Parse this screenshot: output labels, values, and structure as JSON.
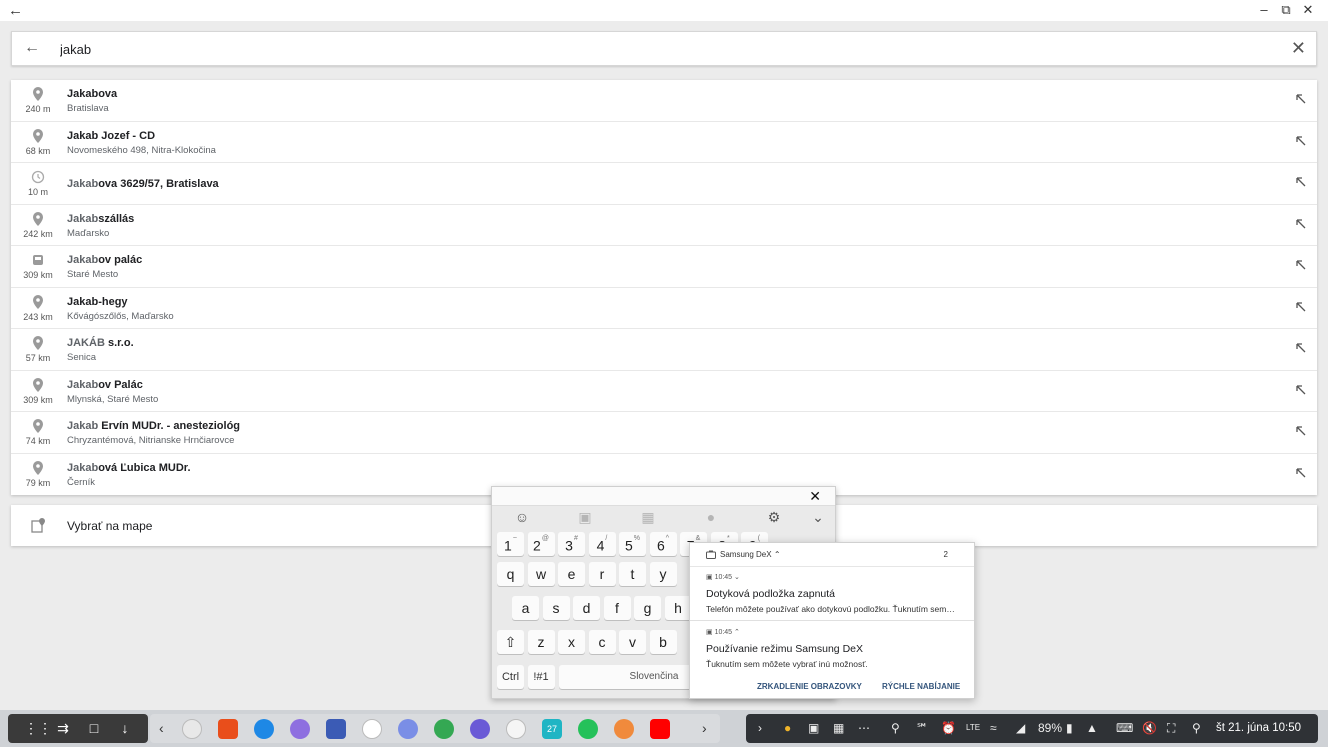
{
  "window": {
    "back_icon": "arrow-left-icon",
    "controls": [
      "minimize-icon",
      "restore-icon",
      "close-icon"
    ]
  },
  "search": {
    "value": "jakab",
    "back_icon": "arrow-left-icon",
    "clear_icon": "close-icon"
  },
  "results": [
    {
      "icon": "place-pin-icon",
      "distance": "240 m",
      "match": "Jakabova",
      "rest": "",
      "subtitle": "Bratislava",
      "match_dim": false
    },
    {
      "icon": "place-pin-icon",
      "distance": "68 km",
      "match": "Jakab Jozef - CD",
      "rest": "",
      "subtitle": "Novomeského 498, Nitra-Klokočina",
      "match_dim": false
    },
    {
      "icon": "history-clock-icon",
      "distance": "10 m",
      "match": "Jakab",
      "rest": "ova 3629/57, Bratislava",
      "subtitle": "",
      "match_dim": true
    },
    {
      "icon": "place-pin-icon",
      "distance": "242 km",
      "match": "Jakab",
      "rest": "szállás",
      "subtitle": "Maďarsko",
      "match_dim": true
    },
    {
      "icon": "bus-stop-icon",
      "distance": "309 km",
      "match": "Jakab",
      "rest": "ov palác",
      "subtitle": "Staré Mesto",
      "match_dim": true
    },
    {
      "icon": "place-pin-icon",
      "distance": "243 km",
      "match": "Jakab-hegy",
      "rest": "",
      "subtitle": "Kővágószőlős, Maďarsko",
      "match_dim": false
    },
    {
      "icon": "place-pin-icon",
      "distance": "57 km",
      "match": "JAKÁB",
      "rest": " s.r.o.",
      "subtitle": "Senica",
      "match_dim": true
    },
    {
      "icon": "place-pin-icon",
      "distance": "309 km",
      "match": "Jakab",
      "rest": "ov Palác",
      "subtitle": "Mlynská, Staré Mesto",
      "match_dim": true
    },
    {
      "icon": "place-pin-icon",
      "distance": "74 km",
      "match": "Jakab",
      "rest": " Ervín MUDr. - anesteziológ",
      "subtitle": "Chryzantémová, Nitrianske Hrnčiarovce",
      "match_dim": true
    },
    {
      "icon": "place-pin-icon",
      "distance": "79 km",
      "match": "Jakab",
      "rest": "ová Ľubica MUDr.",
      "subtitle": "Černík",
      "match_dim": true
    }
  ],
  "map_select": {
    "label": "Vybrať na mape",
    "icon": "map-pin-select-icon"
  },
  "keyboard": {
    "tools": [
      "emoji-icon",
      "sticker-icon",
      "gif-icon",
      "mic-icon",
      "settings-icon",
      "chevron-down-icon"
    ],
    "close_icon": "close-icon",
    "number_row": [
      {
        "k": "1",
        "s": "~"
      },
      {
        "k": "2",
        "s": "@"
      },
      {
        "k": "3",
        "s": "#"
      },
      {
        "k": "4",
        "s": "/"
      },
      {
        "k": "5",
        "s": "%"
      },
      {
        "k": "6",
        "s": "^"
      },
      {
        "k": "7",
        "s": "&"
      },
      {
        "k": "8",
        "s": "*"
      },
      {
        "k": "9",
        "s": "("
      }
    ],
    "row1": [
      "q",
      "w",
      "e",
      "r",
      "t",
      "y"
    ],
    "row2": [
      "a",
      "s",
      "d",
      "f",
      "g",
      "h"
    ],
    "row3": [
      "z",
      "x",
      "c",
      "v",
      "b"
    ],
    "ctrl": "Ctrl",
    "symbols": "!#1",
    "space_label": "Slovenčina",
    "shift_icon": "shift-icon"
  },
  "notification": {
    "app_name": "Samsung DeX",
    "count": "2",
    "items": [
      {
        "time": "10:45",
        "title": "Dotyková podložka zapnutá",
        "text": "Telefón môžete používať ako dotykovú podložku. Ťuknutím sem…"
      },
      {
        "time": "10:45",
        "title": "Používanie režimu Samsung DeX",
        "text": "Ťuknutím sem môžete vybrať inú možnosť."
      }
    ],
    "actions": [
      "ZRKADLENIE OBRAZOVKY",
      "RÝCHLE NABÍJANIE"
    ]
  },
  "taskbar": {
    "left_icons": [
      "apps-grid-icon",
      "recents-icon",
      "square-icon",
      "download-icon"
    ],
    "apps": [
      {
        "name": "gmail-icon",
        "color": "#e8e8e8"
      },
      {
        "name": "office-icon",
        "color": "#e94e1b"
      },
      {
        "name": "messenger-icon",
        "color": "#1e88e5"
      },
      {
        "name": "video-icon",
        "color": "#8e6fe0"
      },
      {
        "name": "facebook-icon",
        "color": "#3b5bb5"
      },
      {
        "name": "clock-icon",
        "color": "#ffffff"
      },
      {
        "name": "camera-icon",
        "color": "#7a8ee6"
      },
      {
        "name": "maps-icon",
        "color": "#34a853"
      },
      {
        "name": "internet-icon",
        "color": "#6a5ad6"
      },
      {
        "name": "mail-icon",
        "color": "#f5f5f5"
      },
      {
        "name": "calendar-icon",
        "color": "#1fb5c4"
      },
      {
        "name": "phone-icon",
        "color": "#25c15a"
      },
      {
        "name": "bixby-icon",
        "color": "#f08a3c"
      },
      {
        "name": "youtube-icon",
        "color": "#ff0000"
      }
    ],
    "calendar_day": "27",
    "battery": "89%",
    "clock": "št 21. júna 10:50"
  }
}
